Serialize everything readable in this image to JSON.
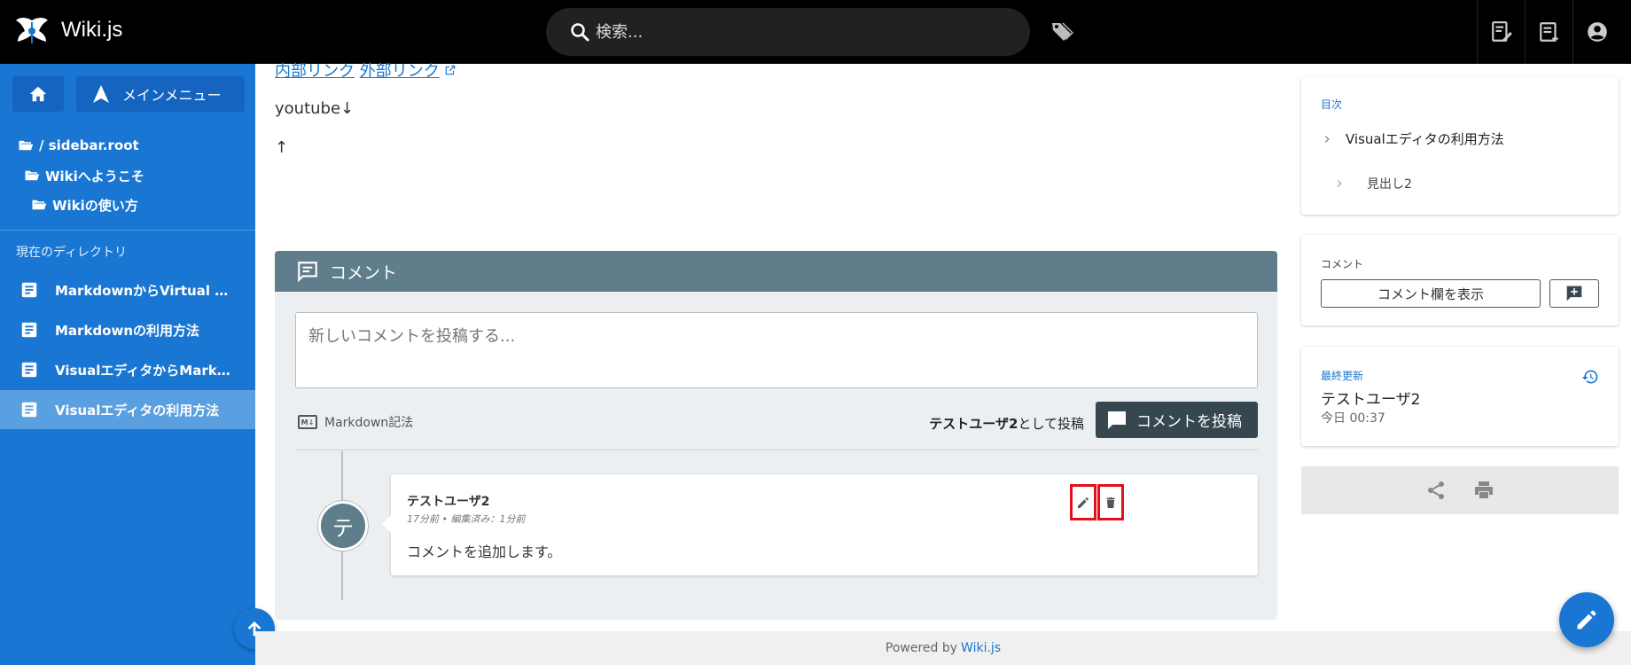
{
  "header": {
    "app_title": "Wiki.js",
    "search_placeholder": "検索...",
    "icons": [
      "logo-icon",
      "search-icon",
      "tags-icon",
      "new-page-icon",
      "page-actions-icon",
      "account-icon"
    ]
  },
  "sidebar": {
    "menu_label": "メインメニュー",
    "tree": [
      {
        "label": "/ sidebar.root"
      },
      {
        "label": "Wikiへようこそ"
      },
      {
        "label": "Wikiの使い方"
      }
    ],
    "section_label": "現在のディレクトリ",
    "items": [
      {
        "label": "MarkdownからVirtual Editorへ",
        "active": false
      },
      {
        "label": "Markdownの利用方法",
        "active": false
      },
      {
        "label": "VisualエディタからMarkdownへ",
        "active": false
      },
      {
        "label": "Visualエディタの利用方法",
        "active": true
      }
    ]
  },
  "content": {
    "internal_link": "内部リンク",
    "external_link": "外部リンク",
    "youtube_text": "youtube↓",
    "up_arrow_text": "↑"
  },
  "comments": {
    "title": "コメント",
    "input_placeholder": "新しいコメントを投稿する...",
    "markdown_label": "Markdown記法",
    "posting_as_user": "テストユーザ2",
    "posting_as_suffix": "として投稿",
    "post_button": "コメントを投稿",
    "list": [
      {
        "avatar_initial": "テ",
        "author": "テストユーザ2",
        "meta": "17分前 • 編集済み：1分前",
        "body": "コメントを追加します。"
      }
    ]
  },
  "toc": {
    "label": "目次",
    "items": [
      {
        "label": "Visualエディタの利用方法",
        "level": 1
      },
      {
        "label": "見出し2",
        "level": 2
      }
    ]
  },
  "comment_panel": {
    "label": "コメント",
    "show_button": "コメント欄を表示"
  },
  "last_updated": {
    "label": "最終更新",
    "user": "テストユーザ2",
    "time": "今日 00:37"
  },
  "footer": {
    "powered_by": "Powered by",
    "link": "Wiki.js"
  },
  "colors": {
    "accent": "#1976d2",
    "comment_header": "#607d8b",
    "highlight": "#e0101e"
  }
}
